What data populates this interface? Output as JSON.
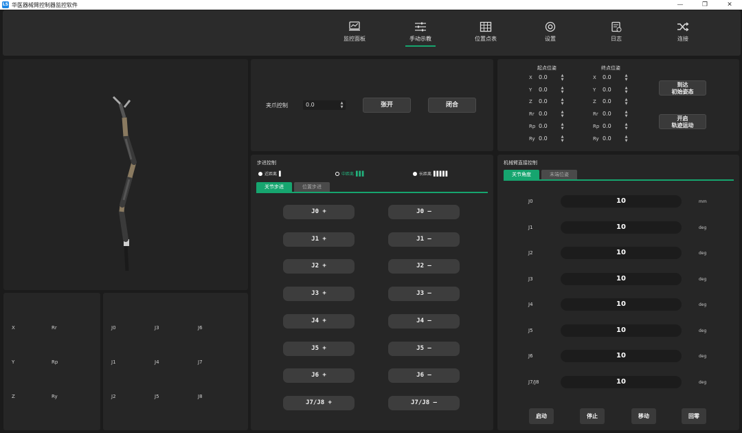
{
  "window": {
    "title": "华医器械臂控制器监控软件",
    "icon_text": "LS"
  },
  "nav": [
    {
      "label": "监控面板",
      "icon": "monitor-icon"
    },
    {
      "label": "手动示教",
      "icon": "sliders-icon",
      "active": true
    },
    {
      "label": "位置点表",
      "icon": "table-icon"
    },
    {
      "label": "设置",
      "icon": "gear-icon"
    },
    {
      "label": "日志",
      "icon": "log-icon"
    },
    {
      "label": "连接",
      "icon": "shuffle-icon"
    }
  ],
  "pose_panel": {
    "labels": [
      "X",
      "Y",
      "Z",
      "Rr",
      "Rp",
      "Ry"
    ]
  },
  "joint_panel": {
    "labels": [
      "J0",
      "J3",
      "J6",
      "J1",
      "J4",
      "J7",
      "J2",
      "J5",
      "J8"
    ]
  },
  "gripper": {
    "label": "夹爪控制",
    "value": "0.0",
    "open": "张开",
    "close": "闭合"
  },
  "trajectory": {
    "start_title": "起点位姿",
    "end_title": "终点位姿",
    "axes": [
      "X",
      "Y",
      "Z",
      "Rr",
      "Rp",
      "Ry"
    ],
    "start_values": [
      "0.0",
      "0.0",
      "0.0",
      "0.0",
      "0.0",
      "0.0"
    ],
    "end_values": [
      "0.0",
      "0.0",
      "0.0",
      "0.0",
      "0.0",
      "0.0"
    ],
    "btn_initial_1": "到达",
    "btn_initial_2": "初始姿态",
    "btn_traj_1": "开启",
    "btn_traj_2": "轨迹运动"
  },
  "step": {
    "title": "步进控制",
    "radios": [
      {
        "label": "近距离",
        "bars": "▌",
        "selected": false
      },
      {
        "label": "中距离",
        "bars": "▌▌▌",
        "selected": true
      },
      {
        "label": "长距离",
        "bars": "▌▌▌▌▌",
        "selected": false
      }
    ],
    "tabs": [
      "关节步进",
      "位置步进"
    ],
    "plus": [
      "J0  +",
      "J1  +",
      "J2  +",
      "J3  +",
      "J4  +",
      "J5  +",
      "J6  +",
      "J7/J8  +"
    ],
    "minus": [
      "J0  —",
      "J1  —",
      "J2  —",
      "J3  —",
      "J4  —",
      "J5  —",
      "J6  —",
      "J7/J8  —"
    ]
  },
  "joint_ctrl": {
    "title": "机械臂直接控制",
    "tabs": [
      "关节角度",
      "末端位姿"
    ],
    "rows": [
      {
        "label": "J0",
        "value": "10",
        "unit": "mm"
      },
      {
        "label": "J1",
        "value": "10",
        "unit": "deg"
      },
      {
        "label": "J2",
        "value": "10",
        "unit": "deg"
      },
      {
        "label": "J3",
        "value": "10",
        "unit": "deg"
      },
      {
        "label": "J4",
        "value": "10",
        "unit": "deg"
      },
      {
        "label": "J5",
        "value": "10",
        "unit": "deg"
      },
      {
        "label": "J6",
        "value": "10",
        "unit": "deg"
      },
      {
        "label": "J7/J8",
        "value": "10",
        "unit": "deg"
      }
    ],
    "actions": [
      "启动",
      "停止",
      "移动",
      "回零"
    ]
  },
  "colors": {
    "accent": "#16a56f",
    "panel": "#262626",
    "background": "#1b1b1b"
  }
}
